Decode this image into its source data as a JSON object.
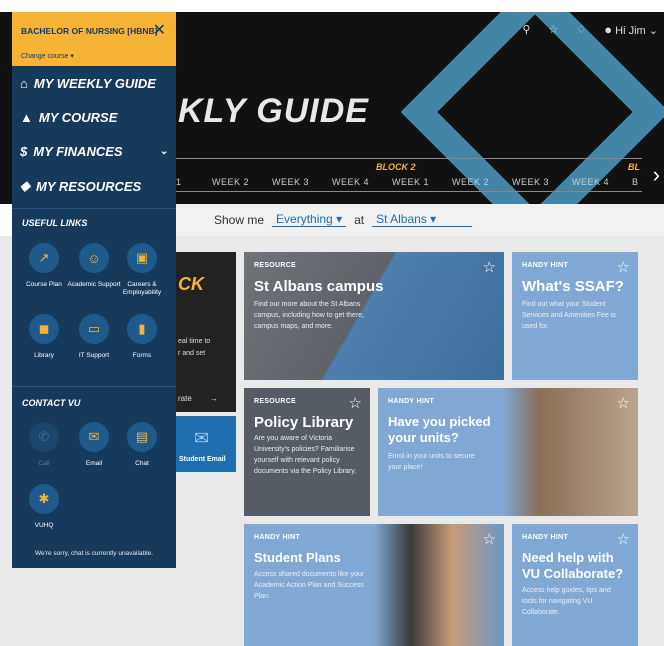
{
  "course": {
    "title": "BACHELOR OF NURSING [HBNB]",
    "change": "Change course"
  },
  "nav": {
    "weekly": "MY WEEKLY GUIDE",
    "course": "MY COURSE",
    "finances": "MY FINANCES",
    "resources": "MY RESOURCES"
  },
  "useful_links": {
    "title": "USEFUL LINKS",
    "items": [
      "Course Plan",
      "Academic Support",
      "Careers & Employability",
      "Library",
      "IT Support",
      "Forms"
    ]
  },
  "contact": {
    "title": "CONTACT VU",
    "items": [
      "Call",
      "Email",
      "Chat",
      "VUHQ"
    ],
    "chat_status": "We're sorry, chat is currently unavailable."
  },
  "topbar": {
    "greeting": "Hi Jim"
  },
  "hero": {
    "title": "KLY GUIDE",
    "block2": "BLOCK 2",
    "block_partial": "BL",
    "weeks": [
      "1",
      "WEEK 2",
      "WEEK 3",
      "WEEK 4",
      "WEEK 1",
      "WEEK 2",
      "WEEK 3",
      "WEEK 4",
      "B"
    ]
  },
  "filter": {
    "show": "Show me",
    "everything": "Everything",
    "at": "at",
    "campus": "St Albans"
  },
  "left_card": {
    "title_partial": "CK",
    "text1": "eal time to",
    "text2": "r and set",
    "rate": "rate",
    "email": "Student Email"
  },
  "cards": [
    {
      "tag": "RESOURCE",
      "title": "St Albans campus",
      "desc": "Find our more about the St Albans campus, including how to get there, campus maps, and more."
    },
    {
      "tag": "HANDY HINT",
      "title": "What's SSAF?",
      "desc": "Find out what your Student Services and Amenities Fee is used for."
    },
    {
      "tag": "RESOURCE",
      "title": "Policy Library",
      "desc": "Are you aware of Victoria University's policies? Familiarise yourself with relevant policy documents via the Policy Library."
    },
    {
      "tag": "HANDY HINT",
      "title": "Have you picked your units?",
      "desc": "Enrol in your units to secure your place!"
    },
    {
      "tag": "HANDY HINT",
      "title": "Student Plans",
      "desc": "Access shared documents like your Academic Action Plan and Success Plan."
    },
    {
      "tag": "HANDY HINT",
      "title": "Need help with VU Collaborate?",
      "desc": "Access help guides, tips and tools for navigating VU Collaborate."
    }
  ],
  "colors": {
    "navy": "#163a5c",
    "gold": "#f6b336",
    "blue": "#7fa9d4",
    "grey": "#555c63"
  }
}
